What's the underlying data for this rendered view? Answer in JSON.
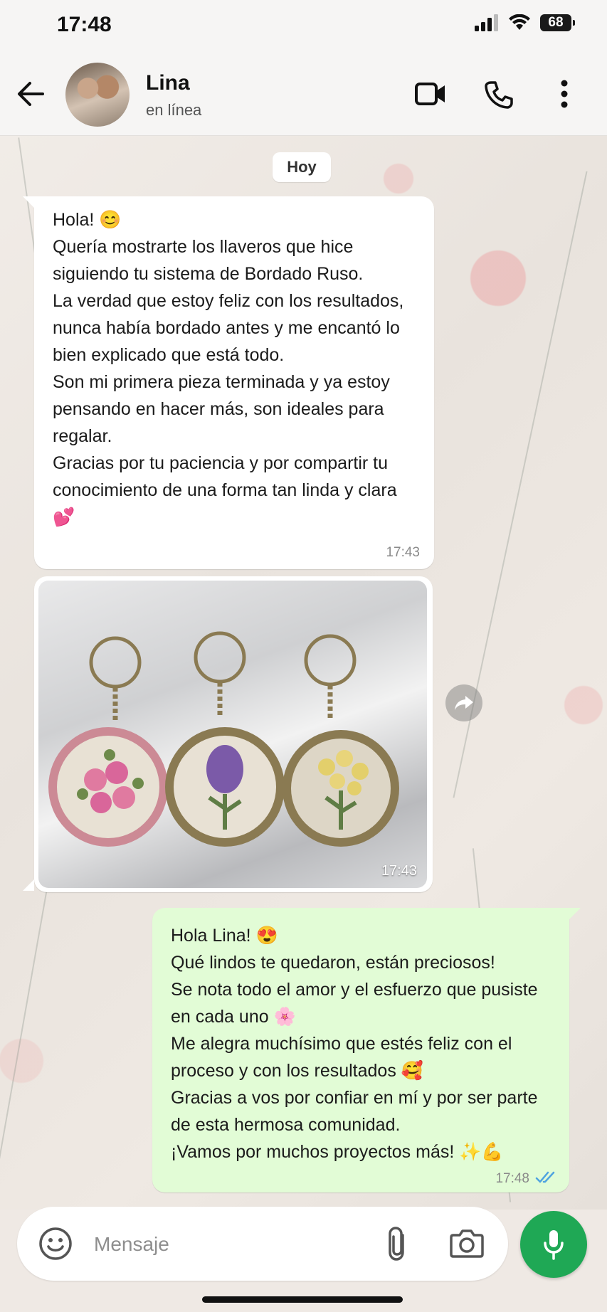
{
  "status_bar": {
    "time": "17:48",
    "battery": "68"
  },
  "header": {
    "contact_name": "Lina",
    "contact_status": "en línea"
  },
  "chat": {
    "day_label": "Hoy",
    "messages": [
      {
        "direction": "incoming",
        "text": "Hola! 😊\nQuería mostrarte los llaveros que hice siguiendo tu sistema de Bordado Ruso.\nLa verdad que estoy feliz con los resultados, nunca había bordado antes y me encantó lo bien explicado que está todo.\nSon mi primera pieza terminada y ya estoy pensando en hacer más, son ideales para regalar.\nGracias por tu paciencia y por compartir tu conocimiento de una forma tan linda y clara 💕",
        "time": "17:43"
      },
      {
        "direction": "incoming",
        "type": "image",
        "time": "17:43"
      },
      {
        "direction": "outgoing",
        "text": "Hola Lina! 😍\nQué lindos te quedaron, están preciosos!\nSe nota todo el amor y el esfuerzo que pusiste en cada uno 🌸\nMe alegra muchísimo que estés feliz con el proceso y con los resultados 🥰\nGracias a vos por confiar en mí y por ser parte de esta hermosa comunidad.\n¡Vamos por muchos proyectos más! ✨💪",
        "time": "17:48"
      }
    ]
  },
  "composer": {
    "placeholder": "Mensaje"
  },
  "colors": {
    "accent": "#1fa855",
    "outgoing_bubble": "#e2fcd6",
    "read_ticks": "#4fa3e0"
  }
}
